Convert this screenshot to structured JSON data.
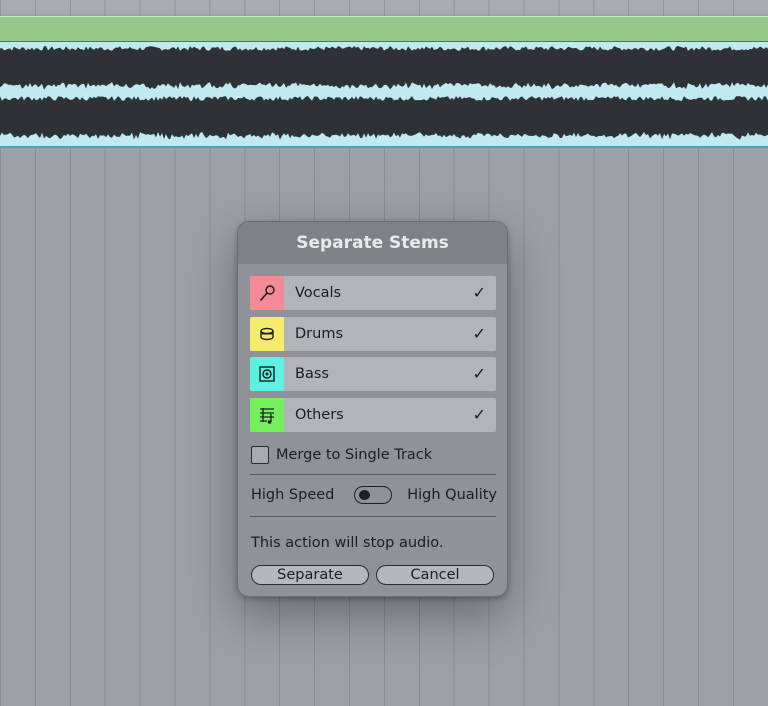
{
  "dialog": {
    "title": "Separate Stems",
    "stems": [
      {
        "label": "Vocals",
        "icon": "microphone-icon",
        "color": "#f48a96",
        "checked": true,
        "check_glyph": "✓"
      },
      {
        "label": "Drums",
        "icon": "drum-icon",
        "color": "#f5ec6c",
        "checked": true,
        "check_glyph": "✓"
      },
      {
        "label": "Bass",
        "icon": "speaker-icon",
        "color": "#5ef0e0",
        "checked": true,
        "check_glyph": "✓"
      },
      {
        "label": "Others",
        "icon": "sheet-music-icon",
        "color": "#74f05e",
        "checked": true,
        "check_glyph": "✓"
      }
    ],
    "merge_label": "Merge to Single Track",
    "merge_checked": false,
    "quality_left": "High Speed",
    "quality_right": "High Quality",
    "quality_mode": "High Speed",
    "warning": "This action will stop audio.",
    "separate_label": "Separate",
    "cancel_label": "Cancel"
  },
  "colors": {
    "clip_header": "#98c88a",
    "clip_body": "#bfeaf2",
    "waveform": "#2e3236",
    "background": "#9da0a6"
  }
}
